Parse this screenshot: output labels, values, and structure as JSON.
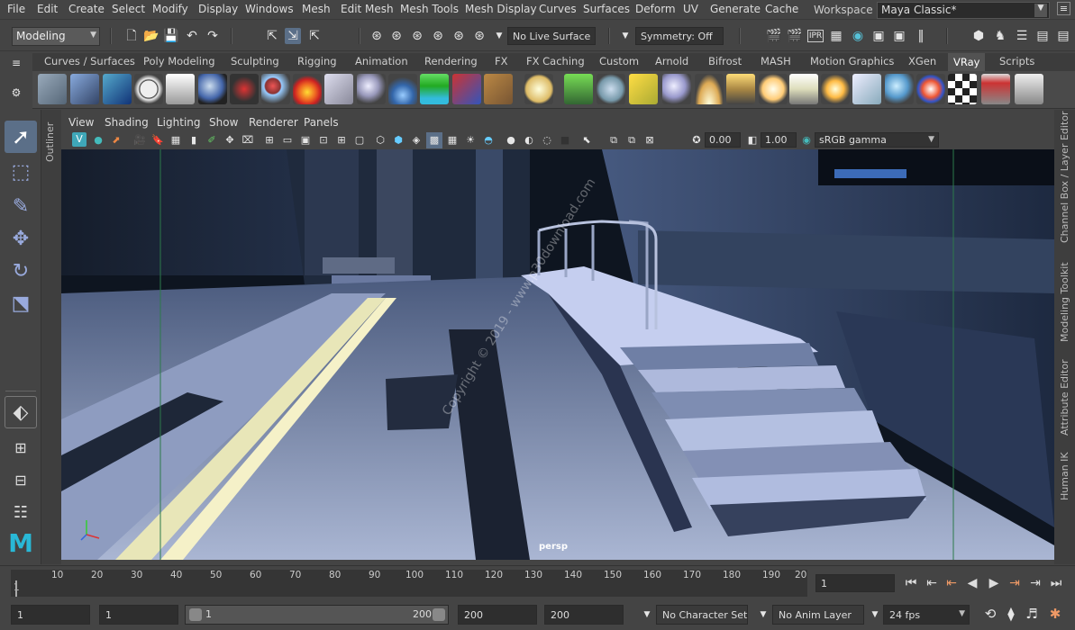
{
  "menu": [
    "File",
    "Edit",
    "Create",
    "Select",
    "Modify",
    "Display",
    "Windows",
    "Mesh",
    "Edit Mesh",
    "Mesh Tools",
    "Mesh Display",
    "Curves",
    "Surfaces",
    "Deform",
    "UV",
    "Generate",
    "Cache"
  ],
  "workspace": {
    "label": "Workspace :",
    "value": "Maya Classic*"
  },
  "statusline": {
    "mode": "Modeling",
    "live_surface": "No Live Surface",
    "symmetry": "Symmetry: Off"
  },
  "shelf_tabs": [
    "Curves / Surfaces",
    "Poly Modeling",
    "Sculpting",
    "Rigging",
    "Animation",
    "Rendering",
    "FX",
    "FX Caching",
    "Custom",
    "Arnold",
    "Bifrost",
    "MASH",
    "Motion Graphics",
    "XGen",
    "VRay",
    "Scripts"
  ],
  "active_shelf_tab": "VRay",
  "panel_menu": [
    "View",
    "Shading",
    "Lighting",
    "Show",
    "Renderer",
    "Panels"
  ],
  "panel_toolbar": {
    "exposure": "0.00",
    "gamma": "1.00",
    "color_space": "sRGB gamma"
  },
  "viewport": {
    "camera_label": "persp",
    "watermark": "Copyright © 2019 - www.p30download.com"
  },
  "side_labels": {
    "left": "Outliner",
    "right": [
      "Channel Box / Layer Editor",
      "Modeling Toolkit",
      "Attribute Editor",
      "Human IK"
    ]
  },
  "timeline": {
    "ticks": [
      "1",
      "10",
      "20",
      "30",
      "40",
      "50",
      "60",
      "70",
      "80",
      "90",
      "100",
      "110",
      "120",
      "130",
      "140",
      "150",
      "160",
      "170",
      "180",
      "190",
      "20"
    ],
    "current_frame": "1"
  },
  "range": {
    "start": "1",
    "anim_start": "1",
    "slider_start": "1",
    "slider_end": "200",
    "anim_end": "200",
    "end": "200",
    "character_set": "No Character Set",
    "anim_layer": "No Anim Layer",
    "fps": "24 fps"
  }
}
